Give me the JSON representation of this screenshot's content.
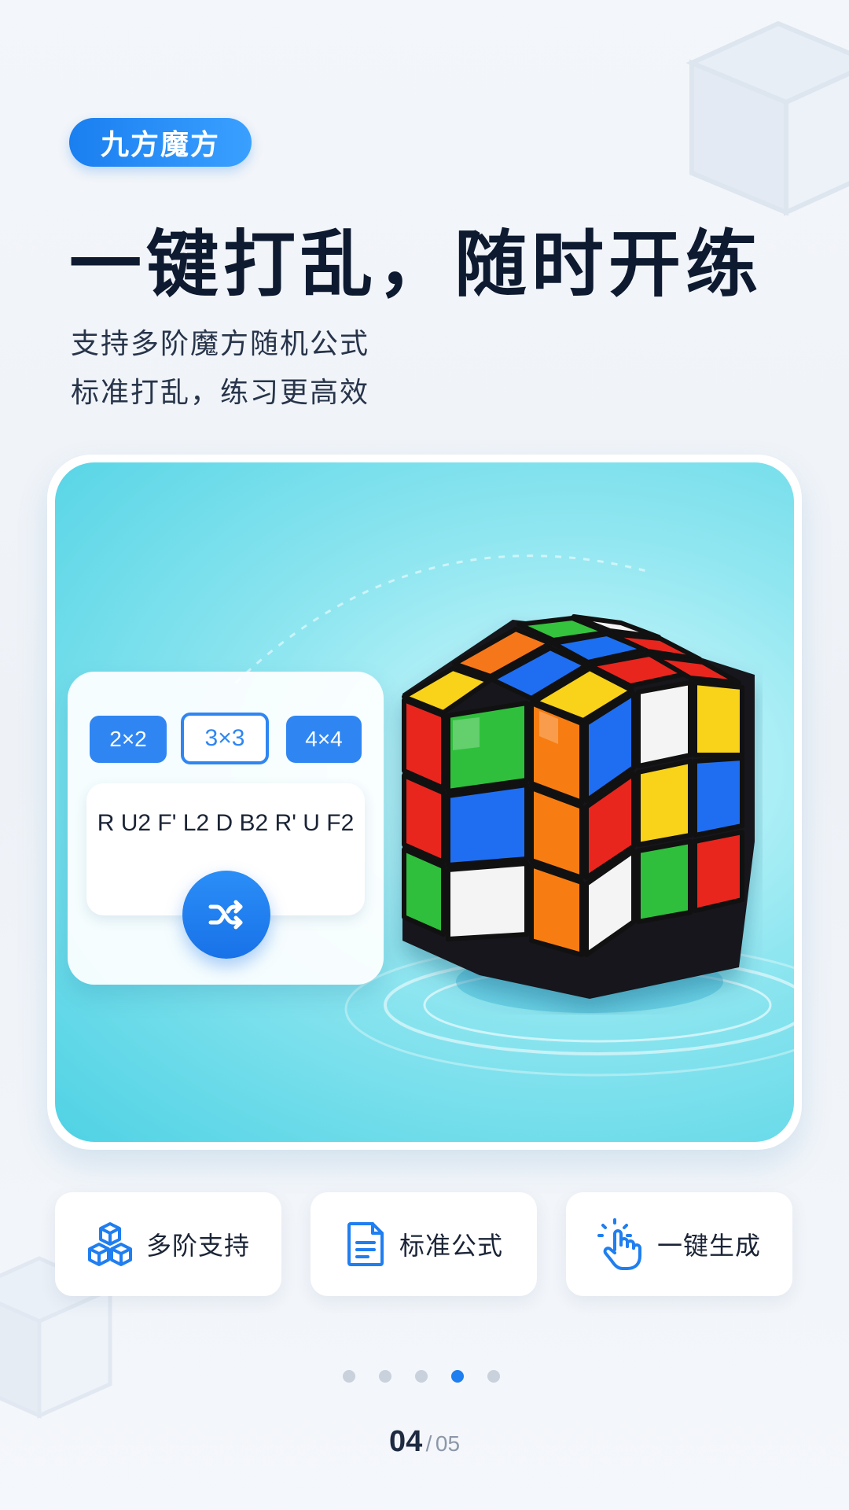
{
  "brand": {
    "name": "九方魔方"
  },
  "headline": "一键打乱，随时开练",
  "subtitle": {
    "line1": "支持多阶魔方随机公式",
    "line2": "标准打乱，练习更高效"
  },
  "scrambler": {
    "sizes": [
      {
        "label": "2×2",
        "selected": false
      },
      {
        "label": "3×3",
        "selected": true
      },
      {
        "label": "4×4",
        "selected": false
      }
    ],
    "formula": "R U2 F' L2 D B2 R' U F2",
    "shuffle_icon": "shuffle-icon",
    "accent": "#2f86f2"
  },
  "features": [
    {
      "icon": "cubes-icon",
      "label": "多阶支持"
    },
    {
      "icon": "document-icon",
      "label": "标准公式"
    },
    {
      "icon": "tap-hand-icon",
      "label": "一键生成"
    }
  ],
  "pagination": {
    "current": "04",
    "separator": "/",
    "total": "05",
    "active_index": 3,
    "count": 5
  },
  "colors": {
    "primary": "#1f7ef0",
    "hero_bg": "#4fd2e4",
    "cube_red": "#e8261e",
    "cube_green": "#2fbf3c",
    "cube_blue": "#1f6ef2",
    "cube_yellow": "#f9d21a",
    "cube_orange": "#f77d12",
    "cube_white": "#f6f6f6"
  }
}
